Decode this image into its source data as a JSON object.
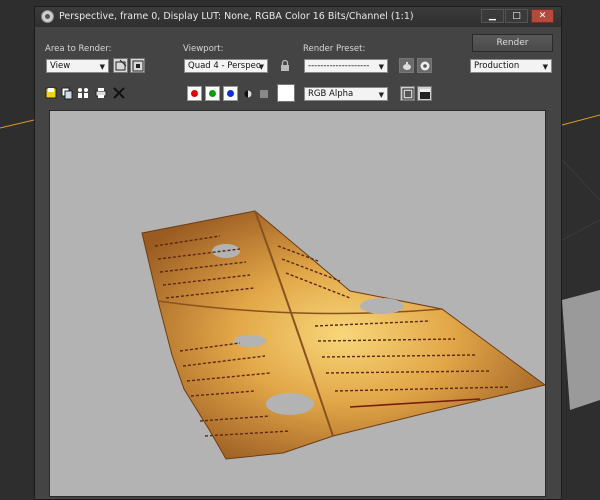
{
  "window": {
    "title": "Perspective, frame 0, Display LUT: None, RGBA Color 16 Bits/Channel (1:1)",
    "controls": [
      "minimize",
      "maximize",
      "close"
    ]
  },
  "toolbar": {
    "area_label": "Area to Render:",
    "area_value": "View",
    "viewport_label": "Viewport:",
    "viewport_value": "Quad 4 - Perspec",
    "preset_label": "Render Preset:",
    "preset_value": "--------------------",
    "render_label": "Render",
    "mode_value": "Production",
    "channel_value": "RGB Alpha"
  },
  "channels": {
    "red": "#e00000",
    "green": "#00a000",
    "blue": "#1030e0"
  },
  "icons": [
    "save-image-icon",
    "copy-image-icon",
    "clone-window-icon",
    "print-icon",
    "clear-icon",
    "monochrome-icon",
    "clear-swatch-icon",
    "lock-icon",
    "display-alpha-icon",
    "toggle-ui-icon"
  ]
}
